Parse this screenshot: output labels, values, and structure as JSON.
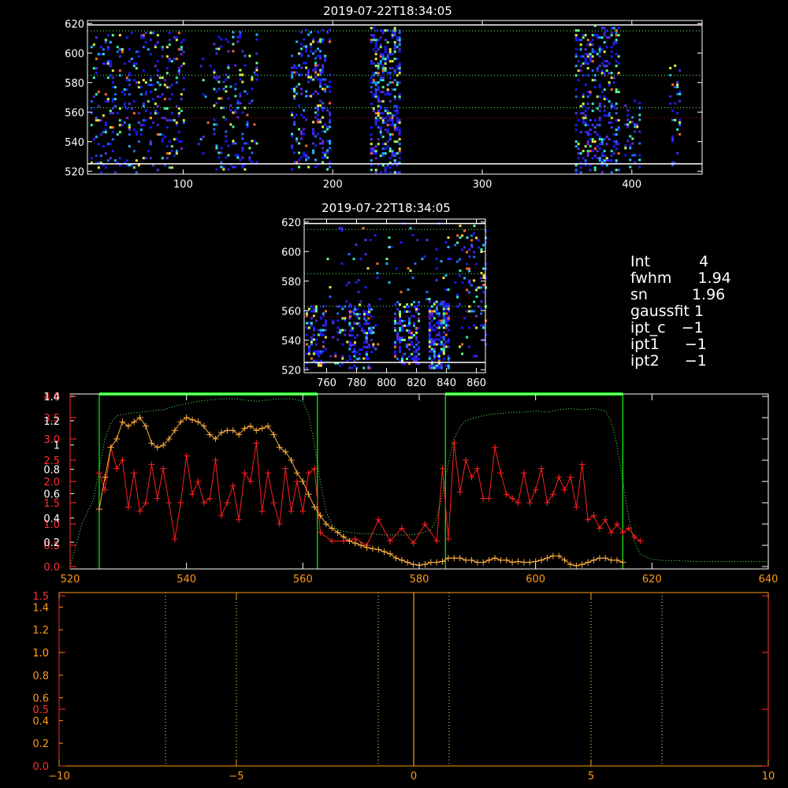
{
  "colors": {
    "background": "#000000",
    "frame": "#ffffff",
    "green": "#00ff00",
    "green_dotted": "#66ff66",
    "red": "#ff2020",
    "orange": "#ffb040",
    "axis_orange": "#ff9a1a",
    "axis_red": "#ff3030",
    "yellow_dotted": "#ffff66",
    "dark_red_dotted": "#c00000"
  },
  "info_panel": {
    "rows": [
      {
        "label": "Int",
        "value": "4"
      },
      {
        "label": "fwhm",
        "value": "1.94"
      },
      {
        "label": "sn",
        "value": "1.96"
      },
      {
        "label": "gaussfit",
        "value": "1"
      },
      {
        "label": "ipt_c",
        "value": "−1"
      },
      {
        "label": "ipt1",
        "value": "−1"
      },
      {
        "label": "ipt2",
        "value": "−1"
      }
    ]
  },
  "chart_data": [
    {
      "type": "heatmap",
      "title": "2019-07-22T18:34:05",
      "xlim": [
        36,
        447
      ],
      "ylim": [
        518,
        622
      ],
      "x_ticks": [
        "100",
        "200",
        "300",
        "400"
      ],
      "x_tick_values": [
        100,
        200,
        300,
        400
      ],
      "y_ticks": [
        "520",
        "540",
        "560",
        "580",
        "600",
        "620"
      ],
      "y_tick_values": [
        520,
        540,
        560,
        580,
        600,
        620
      ],
      "hlines_solid": [
        619,
        525
      ],
      "hlines_dotted_green": [
        615,
        585,
        563
      ],
      "hlines_dotted_red": [
        556
      ],
      "blobs": [
        {
          "x0": 38,
          "x1": 100,
          "y0": 520,
          "y1": 615,
          "density": 0.13
        },
        {
          "x0": 108,
          "x1": 118,
          "y0": 520,
          "y1": 600,
          "density": 0.05
        },
        {
          "x0": 120,
          "x1": 150,
          "y0": 522,
          "y1": 615,
          "density": 0.15
        },
        {
          "x0": 172,
          "x1": 198,
          "y0": 522,
          "y1": 617,
          "density": 0.22
        },
        {
          "x0": 225,
          "x1": 245,
          "y0": 520,
          "y1": 618,
          "density": 0.38
        },
        {
          "x0": 362,
          "x1": 392,
          "y0": 520,
          "y1": 620,
          "density": 0.24
        },
        {
          "x0": 395,
          "x1": 405,
          "y0": 522,
          "y1": 570,
          "density": 0.2
        },
        {
          "x0": 425,
          "x1": 432,
          "y0": 525,
          "y1": 595,
          "density": 0.15
        }
      ]
    },
    {
      "type": "heatmap",
      "title": "2019-07-22T18:34:05",
      "xlim": [
        745,
        866
      ],
      "ylim": [
        518,
        622
      ],
      "x_ticks": [
        "760",
        "780",
        "800",
        "820",
        "840",
        "860"
      ],
      "x_tick_values": [
        760,
        780,
        800,
        820,
        840,
        860
      ],
      "y_ticks": [
        "520",
        "540",
        "560",
        "580",
        "600",
        "620"
      ],
      "y_tick_values": [
        520,
        540,
        560,
        580,
        600,
        620
      ],
      "hlines_solid": [
        619,
        525
      ],
      "hlines_dotted_green": [
        615,
        585,
        563
      ],
      "hlines_dotted_red": [
        556
      ],
      "blobs": [
        {
          "x0": 746,
          "x1": 760,
          "y0": 522,
          "y1": 565,
          "density": 0.3
        },
        {
          "x0": 762,
          "x1": 795,
          "y0": 522,
          "y1": 565,
          "density": 0.15
        },
        {
          "x0": 775,
          "x1": 790,
          "y0": 528,
          "y1": 565,
          "density": 0.35
        },
        {
          "x0": 805,
          "x1": 822,
          "y0": 525,
          "y1": 567,
          "density": 0.45
        },
        {
          "x0": 828,
          "x1": 842,
          "y0": 522,
          "y1": 568,
          "density": 0.6
        },
        {
          "x0": 845,
          "x1": 866,
          "y0": 530,
          "y1": 615,
          "density": 0.1
        },
        {
          "x0": 760,
          "x1": 866,
          "y0": 567,
          "y1": 620,
          "density": 0.05
        }
      ]
    },
    {
      "type": "line",
      "xlim": [
        520,
        640
      ],
      "x_ticks": [
        "520",
        "540",
        "560",
        "580",
        "600",
        "620",
        "640"
      ],
      "x_tick_values": [
        520,
        540,
        560,
        580,
        600,
        620,
        640
      ],
      "left_axis_red_ticks": [
        "0.0",
        "0.5",
        "1.0",
        "1.5",
        "2.0",
        "2.5",
        "3.0",
        "3.5",
        "4.0"
      ],
      "left_axis_red_values": [
        0.0,
        0.5,
        1.0,
        1.5,
        2.0,
        2.5,
        3.0,
        3.5,
        4.0
      ],
      "left_axis_red_ylim": [
        0,
        4.0
      ],
      "left_axis_white_ticks": [
        "0.2",
        "0.4",
        "0.6",
        "0.8",
        "1",
        "1.2",
        "1.4"
      ],
      "left_axis_white_values": [
        0.2,
        0.4,
        0.6,
        0.8,
        1.0,
        1.2,
        1.4
      ],
      "left_axis_white_ylim": [
        0,
        1.4
      ],
      "windows": [
        [
          525,
          562.5
        ],
        [
          584.5,
          615
        ]
      ],
      "series": [
        {
          "color": "red",
          "marker": "+",
          "x": [
            525,
            526,
            527,
            528,
            529,
            530,
            531,
            532,
            533,
            534,
            535,
            536,
            537,
            538,
            539,
            540,
            541,
            542,
            543,
            544,
            545,
            546,
            547,
            548,
            549,
            550,
            551,
            552,
            553,
            554,
            555,
            556,
            557,
            558,
            559,
            560,
            561,
            562,
            563,
            565,
            567,
            569,
            571,
            573,
            575,
            577,
            579,
            581,
            583,
            584,
            585,
            586,
            587,
            588,
            589,
            590,
            591,
            592,
            593,
            594,
            595,
            596,
            597,
            598,
            599,
            600,
            601,
            602,
            603,
            604,
            605,
            606,
            607,
            608,
            609,
            610,
            611,
            612,
            613,
            614,
            615,
            616,
            617,
            618
          ],
          "y": [
            2.2,
            1.8,
            2.8,
            2.3,
            2.5,
            1.4,
            2.2,
            1.3,
            1.5,
            2.4,
            1.6,
            2.3,
            1.5,
            0.65,
            1.5,
            2.6,
            1.7,
            2.0,
            1.5,
            1.6,
            2.5,
            1.2,
            1.5,
            1.9,
            1.1,
            2.2,
            2.0,
            2.9,
            1.3,
            2.2,
            1.5,
            1.0,
            2.3,
            1.3,
            2.0,
            1.3,
            2.2,
            2.3,
            0.8,
            0.6,
            0.6,
            0.65,
            0.5,
            1.1,
            0.6,
            0.9,
            0.55,
            1.0,
            0.6,
            2.3,
            0.65,
            2.9,
            1.75,
            2.5,
            2.1,
            2.3,
            1.6,
            1.6,
            2.8,
            2.2,
            1.7,
            1.6,
            1.5,
            2.2,
            1.5,
            1.8,
            2.3,
            1.5,
            1.7,
            2.1,
            1.8,
            2.1,
            1.4,
            2.4,
            1.1,
            1.2,
            0.9,
            1.1,
            0.8,
            1.0,
            0.8,
            0.9,
            0.7,
            0.6
          ]
        },
        {
          "color": "orange",
          "marker": "+",
          "x": [
            525,
            526,
            527,
            528,
            529,
            530,
            531,
            532,
            533,
            534,
            535,
            536,
            537,
            538,
            539,
            540,
            541,
            542,
            543,
            544,
            545,
            546,
            547,
            548,
            549,
            550,
            551,
            552,
            553,
            554,
            555,
            556,
            557,
            558,
            559,
            560,
            561,
            562,
            563,
            564,
            565,
            566,
            567,
            568,
            569,
            570,
            571,
            572,
            573,
            574,
            575,
            576,
            577,
            578,
            579,
            580,
            581,
            582,
            583,
            584,
            585,
            586,
            587,
            588,
            589,
            590,
            591,
            592,
            593,
            594,
            595,
            596,
            597,
            598,
            599,
            600,
            601,
            602,
            603,
            604,
            605,
            606,
            607,
            608,
            609,
            610,
            611,
            612,
            613,
            614,
            615
          ],
          "y": [
            1.35,
            2.1,
            2.8,
            3.0,
            3.4,
            3.3,
            3.4,
            3.5,
            3.3,
            2.9,
            2.8,
            2.85,
            3.0,
            3.2,
            3.4,
            3.5,
            3.45,
            3.4,
            3.3,
            3.1,
            3.0,
            3.15,
            3.2,
            3.2,
            3.1,
            3.25,
            3.3,
            3.2,
            3.25,
            3.3,
            3.1,
            2.8,
            2.7,
            2.5,
            2.2,
            2.0,
            1.7,
            1.4,
            1.2,
            1.0,
            0.9,
            0.8,
            0.7,
            0.6,
            0.55,
            0.5,
            0.45,
            0.42,
            0.4,
            0.35,
            0.3,
            0.2,
            0.15,
            0.1,
            0.05,
            0.03,
            0.05,
            0.1,
            0.1,
            0.12,
            0.2,
            0.2,
            0.2,
            0.15,
            0.15,
            0.1,
            0.1,
            0.15,
            0.2,
            0.15,
            0.15,
            0.1,
            0.12,
            0.1,
            0.1,
            0.12,
            0.15,
            0.2,
            0.25,
            0.25,
            0.15,
            0.05,
            0.02,
            0.05,
            0.1,
            0.15,
            0.2,
            0.2,
            0.15,
            0.15,
            0.1
          ]
        },
        {
          "color": "green",
          "style": "dotted",
          "scale": "white",
          "x": [
            520,
            522,
            524,
            525,
            526,
            527,
            528,
            530,
            532,
            534,
            536,
            538,
            540,
            542,
            544,
            546,
            548,
            550,
            552,
            554,
            556,
            558,
            560,
            561,
            562,
            563,
            564,
            565,
            566,
            568,
            570,
            572,
            574,
            576,
            578,
            580,
            582,
            583,
            584,
            585,
            586,
            587,
            588,
            590,
            592,
            594,
            596,
            598,
            600,
            602,
            604,
            606,
            608,
            610,
            612,
            613,
            614,
            615,
            616,
            617,
            618,
            620,
            622,
            624,
            628,
            632,
            636,
            640
          ],
          "y": [
            0.0,
            0.35,
            0.55,
            0.8,
            1.05,
            1.18,
            1.24,
            1.26,
            1.27,
            1.28,
            1.29,
            1.32,
            1.34,
            1.36,
            1.37,
            1.38,
            1.38,
            1.37,
            1.36,
            1.37,
            1.38,
            1.38,
            1.36,
            1.25,
            1.0,
            0.7,
            0.45,
            0.35,
            0.3,
            0.28,
            0.27,
            0.27,
            0.26,
            0.26,
            0.26,
            0.27,
            0.3,
            0.4,
            0.6,
            0.85,
            1.05,
            1.15,
            1.2,
            1.23,
            1.25,
            1.26,
            1.27,
            1.27,
            1.28,
            1.27,
            1.29,
            1.3,
            1.29,
            1.3,
            1.28,
            1.2,
            1.0,
            0.7,
            0.4,
            0.2,
            0.1,
            0.06,
            0.05,
            0.05,
            0.04,
            0.04,
            0.04,
            0.04
          ]
        }
      ]
    },
    {
      "type": "line",
      "xlim": [
        -10,
        10
      ],
      "x_ticks": [
        "−10",
        "−5",
        "0",
        "5",
        "10"
      ],
      "x_tick_values": [
        -10,
        -5,
        0,
        5,
        10
      ],
      "left_axis_red_ticks": [
        "0.0",
        "0.5",
        "1.0",
        "1.5"
      ],
      "left_axis_red_values": [
        0.0,
        0.5,
        1.0,
        1.5
      ],
      "left_axis_red_ylim": [
        0,
        1.5
      ],
      "left_axis_orange_ticks": [
        "0.2",
        "0.4",
        "0.6",
        "0.8",
        "1.0",
        "1.2",
        "1.4"
      ],
      "left_axis_orange_values": [
        0.2,
        0.4,
        0.6,
        0.8,
        1.0,
        1.2,
        1.4
      ],
      "left_axis_orange_ylim": [
        0,
        1.5
      ],
      "vlines_dotted": [
        -7,
        -5,
        -1,
        1,
        5,
        7
      ],
      "vline_solid": [
        0
      ]
    }
  ]
}
